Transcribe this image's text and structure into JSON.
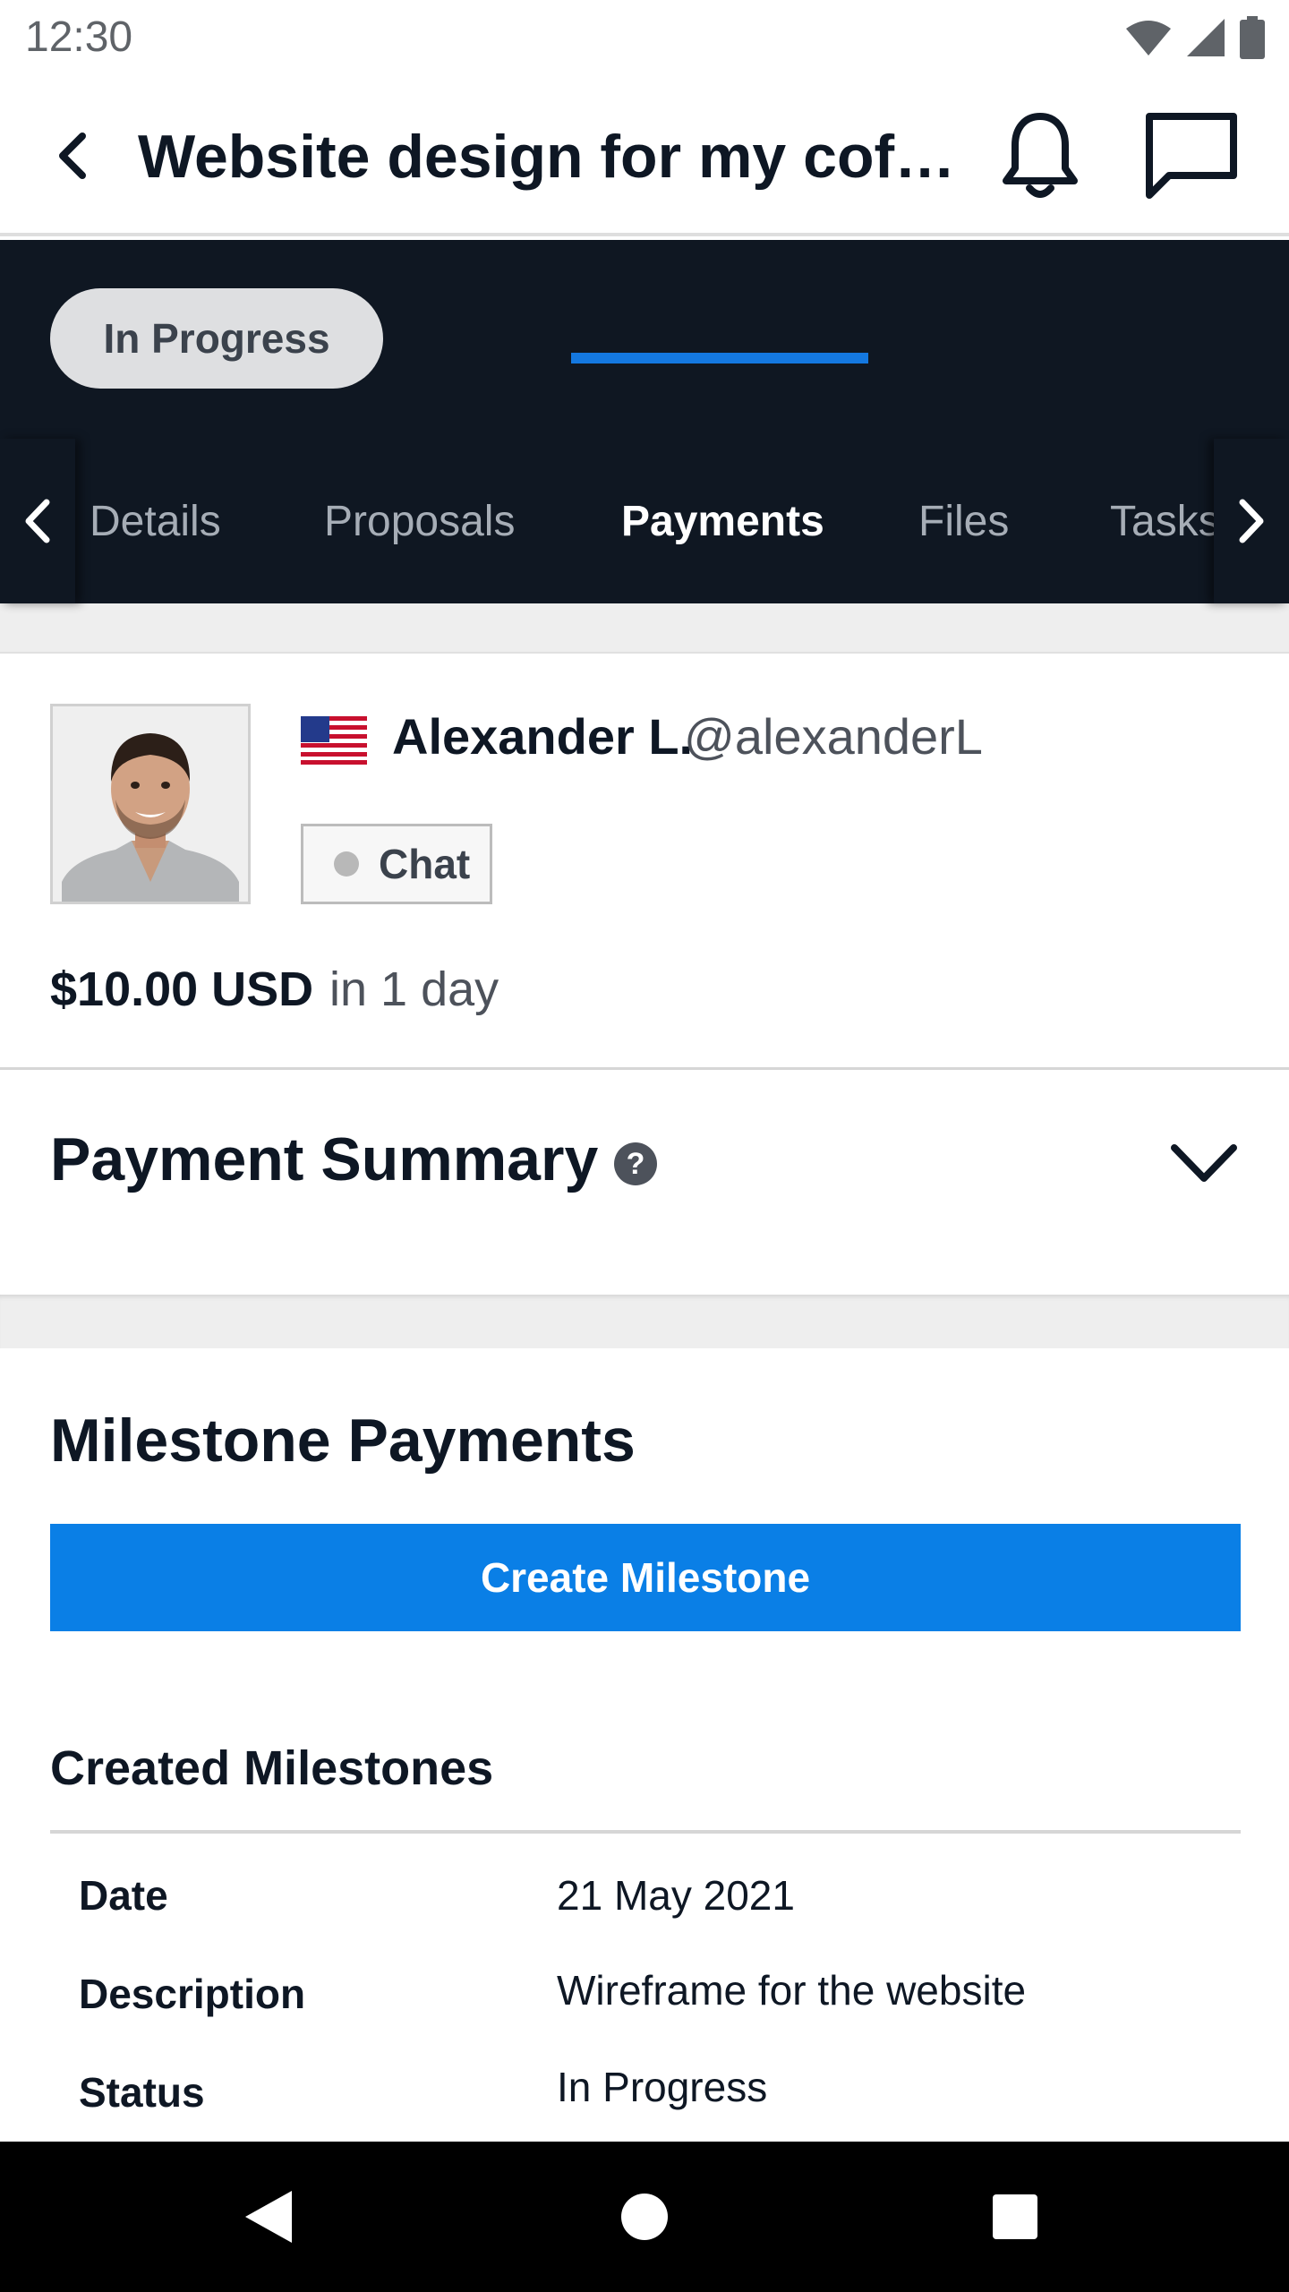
{
  "status_bar": {
    "time": "12:30",
    "icons": [
      "wifi-icon",
      "cell-signal-icon",
      "battery-icon"
    ]
  },
  "app_bar": {
    "title": "Website design for my coffee shop",
    "icons": [
      "back-arrow-icon",
      "bell-icon",
      "message-icon"
    ]
  },
  "project": {
    "status": "In Progress"
  },
  "tabs": {
    "items": [
      {
        "label": "Details"
      },
      {
        "label": "Proposals"
      },
      {
        "label": "Payments"
      },
      {
        "label": "Files"
      },
      {
        "label": "Tasks"
      }
    ],
    "active": "Payments"
  },
  "freelancer": {
    "name": "Alexander L.",
    "handle": "@alexanderL",
    "flag": "us-flag-icon",
    "chat_label": "Chat",
    "amount": "$10.00 USD",
    "amount_suffix": "in 1 day"
  },
  "payment_summary": {
    "title": "Payment Summary",
    "help_symbol": "?"
  },
  "milestones": {
    "title": "Milestone Payments",
    "create_label": "Create Milestone",
    "created_title": "Created Milestones",
    "rows": [
      {
        "label": "Date",
        "value": "21 May 2021"
      },
      {
        "label": "Description",
        "value": "Wireframe for the website"
      },
      {
        "label": "Status",
        "value": "In Progress"
      }
    ]
  },
  "colors": {
    "dark_header": "#0f1722",
    "accent_blue": "#0a7fe6",
    "tab_indicator": "#1478e0"
  }
}
